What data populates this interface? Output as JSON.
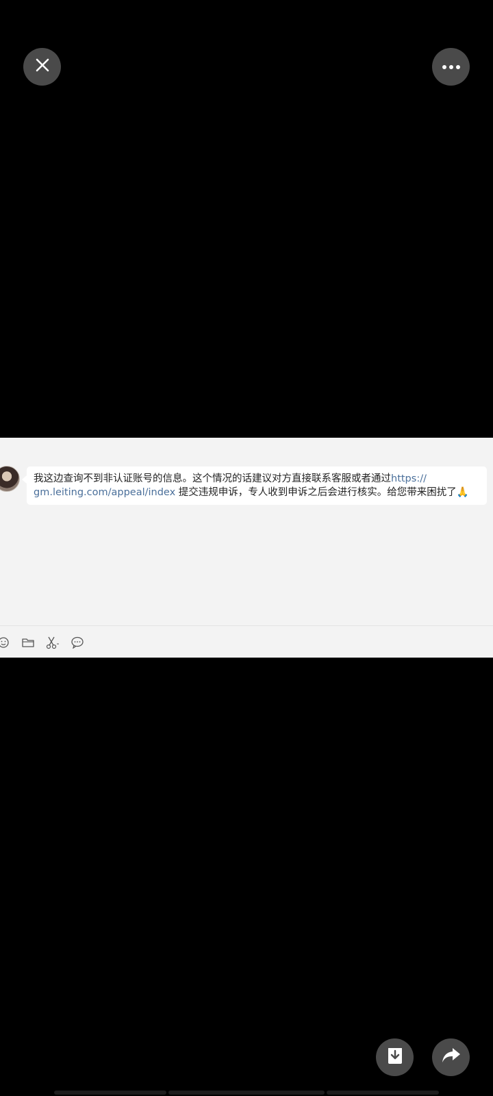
{
  "viewer": {
    "icons": {
      "close": "close-icon",
      "more": "more-icon",
      "download": "download-icon",
      "share": "share-icon"
    },
    "colors": {
      "background": "#000000",
      "button": "#4a4a4a",
      "link": "#4a6f9a"
    }
  },
  "chat": {
    "message": {
      "part1": "我这边查询不到非认证账号的信息。这个情况的话建议对方直接联系客服或者通过",
      "link": "https://\ngm.leiting.com/appeal/index",
      "part2": " 提交违规申诉，专人收到申诉之后会进行核实。给您带来困扰了",
      "emoji": "🙏"
    },
    "toolbar": {
      "icons": [
        "emoji-icon",
        "folder-icon",
        "scissors-icon",
        "comment-icon"
      ]
    }
  }
}
